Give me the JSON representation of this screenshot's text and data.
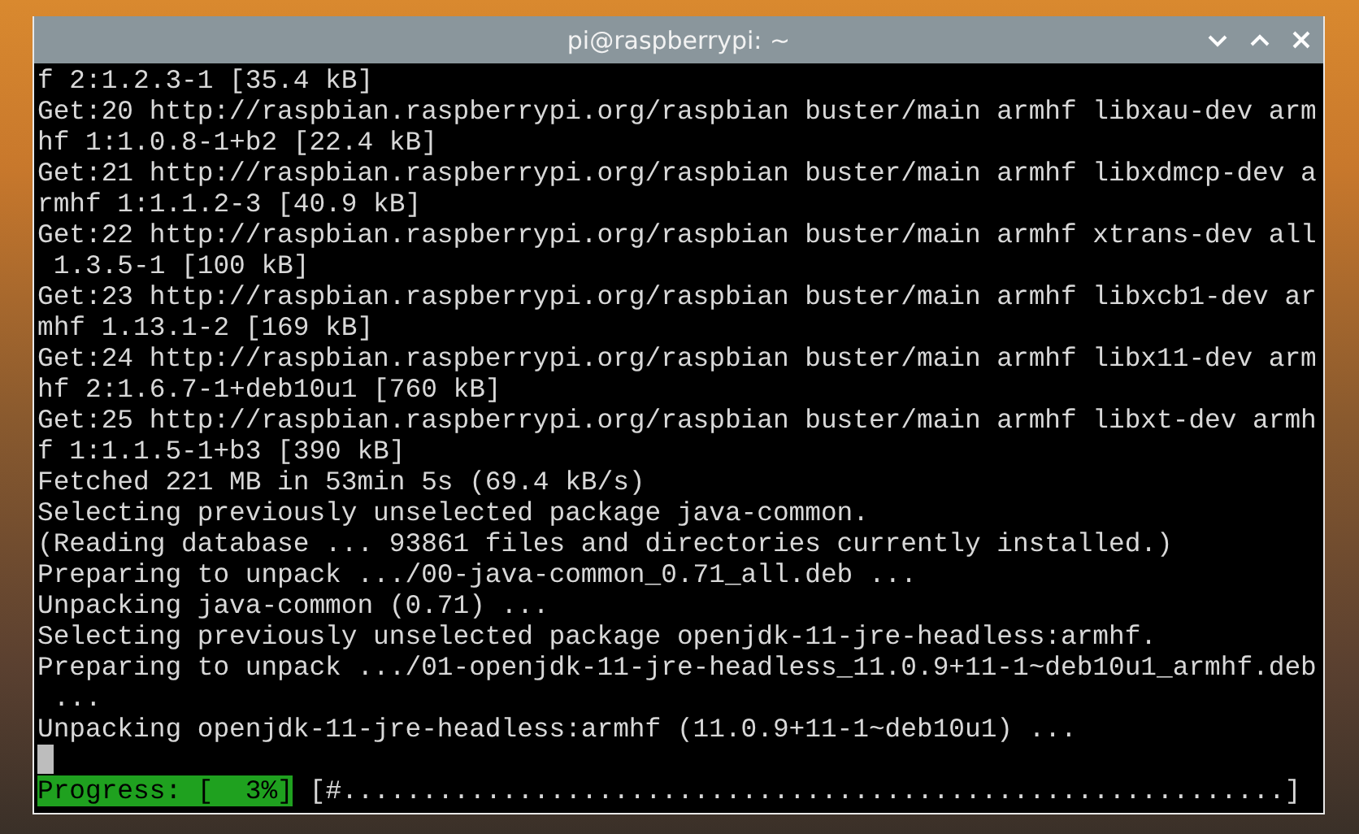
{
  "window": {
    "title": "pi@raspberrypi: ~"
  },
  "terminal": {
    "lines": [
      "f 2:1.2.3-1 [35.4 kB]",
      "Get:20 http://raspbian.raspberrypi.org/raspbian buster/main armhf libxau-dev arm",
      "hf 1:1.0.8-1+b2 [22.4 kB]",
      "Get:21 http://raspbian.raspberrypi.org/raspbian buster/main armhf libxdmcp-dev a",
      "rmhf 1:1.1.2-3 [40.9 kB]",
      "Get:22 http://raspbian.raspberrypi.org/raspbian buster/main armhf xtrans-dev all",
      " 1.3.5-1 [100 kB]",
      "Get:23 http://raspbian.raspberrypi.org/raspbian buster/main armhf libxcb1-dev ar",
      "mhf 1.13.1-2 [169 kB]",
      "Get:24 http://raspbian.raspberrypi.org/raspbian buster/main armhf libx11-dev arm",
      "hf 2:1.6.7-1+deb10u1 [760 kB]",
      "Get:25 http://raspbian.raspberrypi.org/raspbian buster/main armhf libxt-dev armh",
      "f 1:1.1.5-1+b3 [390 kB]",
      "Fetched 221 MB in 53min 5s (69.4 kB/s)",
      "Selecting previously unselected package java-common.",
      "(Reading database ... 93861 files and directories currently installed.)",
      "Preparing to unpack .../00-java-common_0.71_all.deb ...",
      "Unpacking java-common (0.71) ...",
      "Selecting previously unselected package openjdk-11-jre-headless:armhf.",
      "Preparing to unpack .../01-openjdk-11-jre-headless_11.0.9+11-1~deb10u1_armhf.deb",
      " ...",
      "Unpacking openjdk-11-jre-headless:armhf (11.0.9+11-1~deb10u1) ..."
    ],
    "progress": {
      "label": "Progress: [  3%]",
      "bar": "[#...........................................................]"
    }
  }
}
